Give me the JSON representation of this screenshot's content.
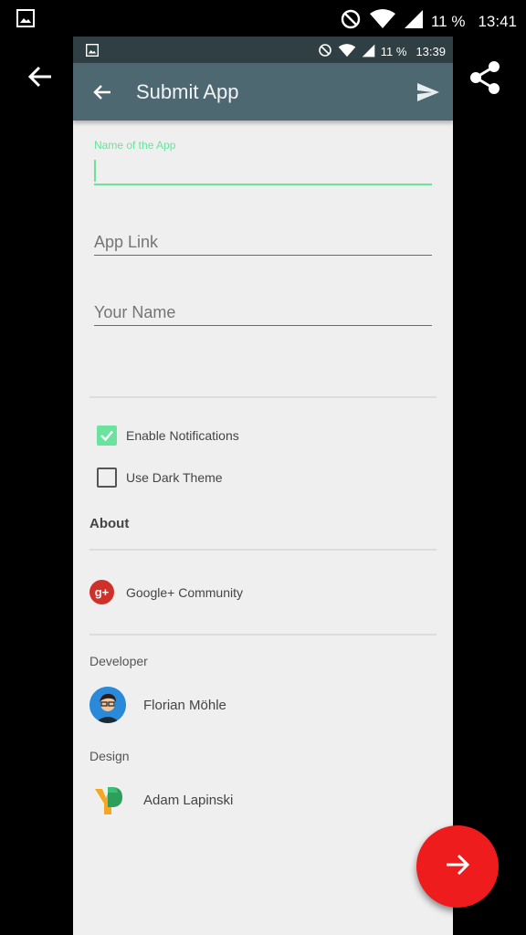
{
  "outer_status": {
    "battery_text": "11 %",
    "time": "13:41"
  },
  "inner_status": {
    "battery_text": "11 %",
    "time": "13:39"
  },
  "toolbar": {
    "title": "Submit App"
  },
  "form": {
    "app_name_label": "Name of the App",
    "app_name_value": "",
    "app_link_placeholder": "App Link",
    "your_name_placeholder": "Your Name"
  },
  "settings": {
    "notifications_label": "Enable Notifications",
    "notifications_checked": true,
    "dark_theme_label": "Use Dark Theme",
    "dark_theme_checked": false
  },
  "about": {
    "title": "About",
    "community_label": "Google+ Community",
    "developer_label": "Developer",
    "developer_name": "Florian Möhle",
    "design_label": "Design",
    "designer_name": "Adam Lapinski"
  },
  "icons": {
    "outer_back": "arrow-left-icon",
    "outer_share": "share-icon",
    "toolbar_back": "arrow-left-icon",
    "toolbar_send": "send-icon",
    "fab": "arrow-right-icon"
  },
  "colors": {
    "accent": "#69e39e",
    "toolbar": "#4e6872",
    "status_bar": "#2f3f44",
    "fab": "#ee1c1c",
    "background": "#efefef"
  }
}
